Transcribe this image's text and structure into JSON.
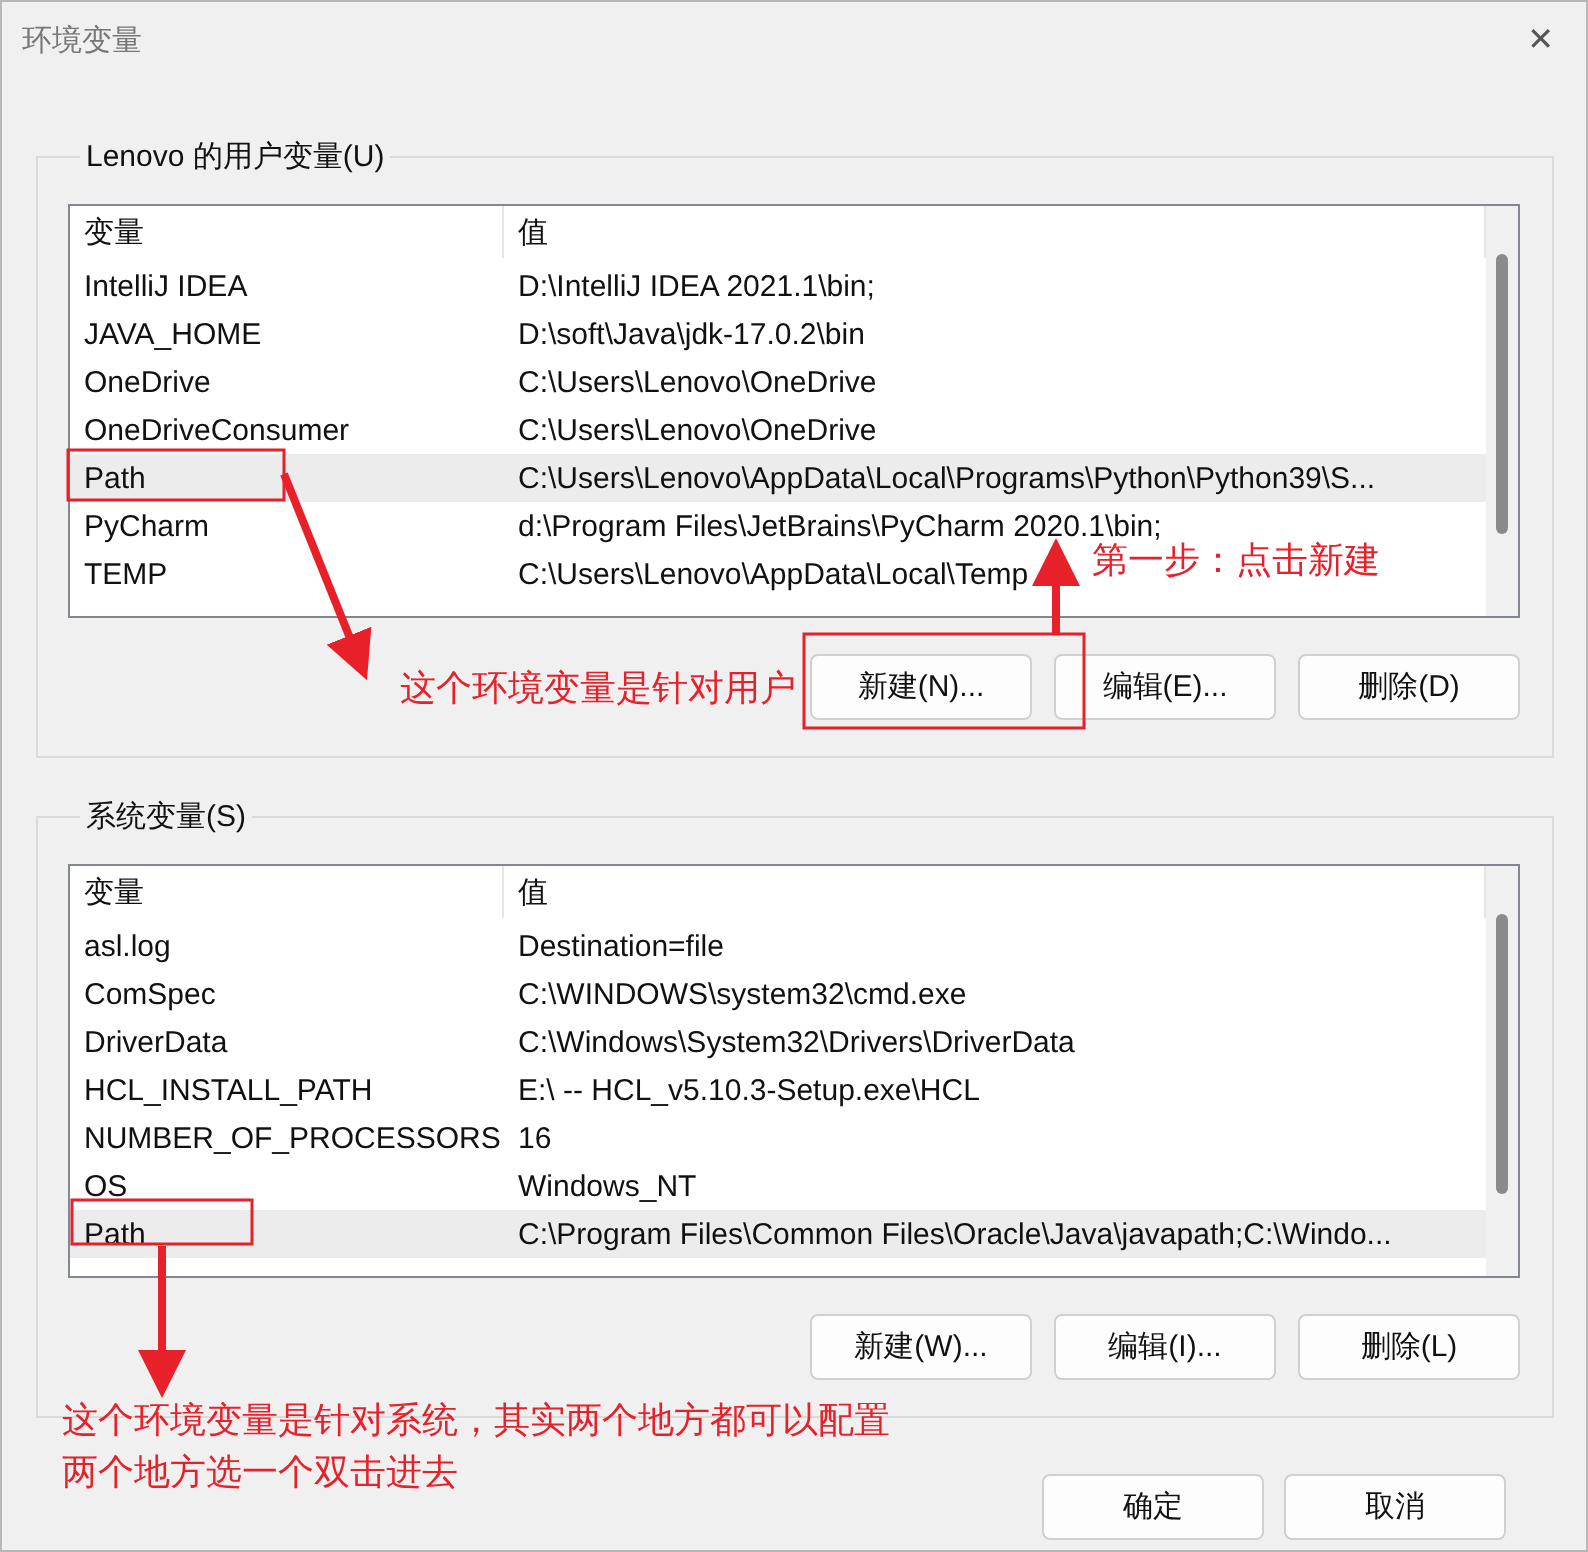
{
  "window": {
    "title": "环境变量",
    "close": "✕"
  },
  "user_vars": {
    "label": "Lenovo 的用户变量(U)",
    "columns": [
      "变量",
      "值"
    ],
    "rows": [
      {
        "name": "IntelliJ IDEA",
        "value": "D:\\IntelliJ IDEA 2021.1\\bin;",
        "selected": false
      },
      {
        "name": "JAVA_HOME",
        "value": "D:\\soft\\Java\\jdk-17.0.2\\bin",
        "selected": false
      },
      {
        "name": "OneDrive",
        "value": "C:\\Users\\Lenovo\\OneDrive",
        "selected": false
      },
      {
        "name": "OneDriveConsumer",
        "value": "C:\\Users\\Lenovo\\OneDrive",
        "selected": false
      },
      {
        "name": "Path",
        "value": "C:\\Users\\Lenovo\\AppData\\Local\\Programs\\Python\\Python39\\S...",
        "selected": true
      },
      {
        "name": "PyCharm",
        "value": "d:\\Program Files\\JetBrains\\PyCharm 2020.1\\bin;",
        "selected": false
      },
      {
        "name": "TEMP",
        "value": "C:\\Users\\Lenovo\\AppData\\Local\\Temp",
        "selected": false
      }
    ],
    "buttons": [
      "新建(N)...",
      "编辑(E)...",
      "删除(D)"
    ]
  },
  "system_vars": {
    "label": "系统变量(S)",
    "columns": [
      "变量",
      "值"
    ],
    "rows": [
      {
        "name": "asl.log",
        "value": "Destination=file",
        "selected": false
      },
      {
        "name": "ComSpec",
        "value": "C:\\WINDOWS\\system32\\cmd.exe",
        "selected": false
      },
      {
        "name": "DriverData",
        "value": "C:\\Windows\\System32\\Drivers\\DriverData",
        "selected": false
      },
      {
        "name": "HCL_INSTALL_PATH",
        "value": "E:\\ -- HCL_v5.10.3-Setup.exe\\HCL",
        "selected": false
      },
      {
        "name": "NUMBER_OF_PROCESSORS",
        "value": "16",
        "selected": false
      },
      {
        "name": "OS",
        "value": "Windows_NT",
        "selected": false
      },
      {
        "name": "Path",
        "value": "C:\\Program Files\\Common Files\\Oracle\\Java\\javapath;C:\\Windo...",
        "selected": true
      }
    ],
    "buttons": [
      "新建(W)...",
      "编辑(I)...",
      "删除(L)"
    ]
  },
  "footer_buttons": [
    "确定",
    "取消"
  ],
  "annotations": [
    {
      "kind": "note",
      "text": "第一步：点击新建"
    },
    {
      "kind": "note",
      "text": "这个环境变量是针对用户"
    },
    {
      "kind": "note",
      "text": "这个环境变量是针对系统，其实两个地方都可以配置"
    },
    {
      "kind": "note",
      "text": "两个地方选一个双击进去"
    }
  ]
}
